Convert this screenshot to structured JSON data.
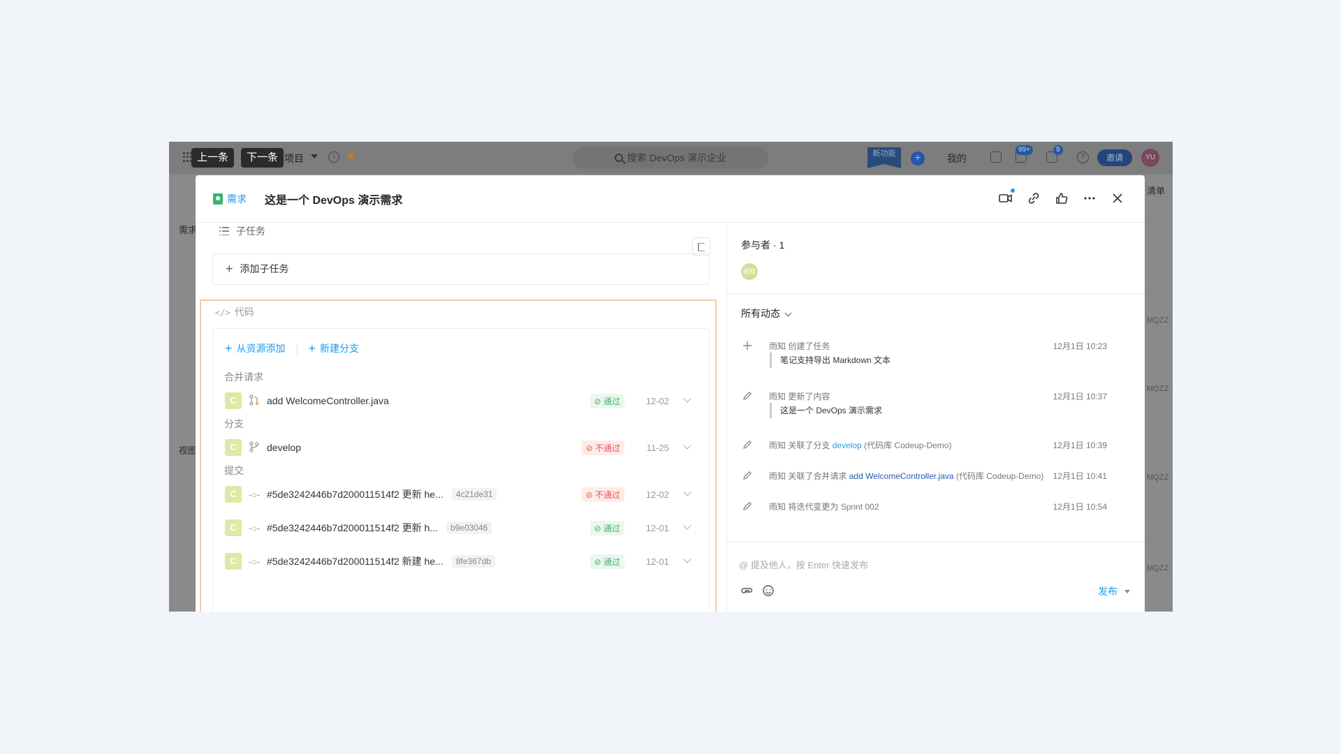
{
  "topbar": {
    "prev": "上一条",
    "next": "下一条",
    "project": "项目",
    "search_placeholder": "搜索 DevOps 演示企业",
    "new_feature": "新功能",
    "mine": "我的",
    "badge_notify": "99+",
    "badge_msg": "9",
    "invite": "邀请",
    "avatar": "YU"
  },
  "background": {
    "left_req": "需求",
    "left_view": "视图",
    "right_list": "清单",
    "mqzz": "MQZZ"
  },
  "modal": {
    "tag": "需求",
    "title": "这是一个 DevOps 演示需求",
    "subtask": {
      "label": "子任务",
      "add": "添加子任务"
    },
    "code": {
      "label": "代码",
      "add_from_resource": "从资源添加",
      "new_branch": "新建分支",
      "merge_title": "合并请求",
      "branch_title": "分支",
      "commit_title": "提交",
      "merge_rows": [
        {
          "badge": "C",
          "text": "add WelcomeController.java",
          "status": "通过",
          "date": "12-02"
        }
      ],
      "branch_rows": [
        {
          "badge": "C",
          "text": "develop",
          "status": "不通过",
          "date": "11-25"
        }
      ],
      "commit_rows": [
        {
          "badge": "C",
          "text": "#5de3242446b7d200011514f2 更新 he...",
          "hash": "4c21de31",
          "status": "不通过",
          "date": "12-02"
        },
        {
          "badge": "C",
          "text": "#5de3242446b7d200011514f2 更新 h...",
          "hash": "b9e03046",
          "status": "通过",
          "date": "12-01"
        },
        {
          "badge": "C",
          "text": "#5de3242446b7d200011514f2 新建 he...",
          "hash": "8fe367db",
          "status": "通过",
          "date": "12-01"
        }
      ]
    },
    "right": {
      "participants": "参与者 · 1",
      "participant_avatar": "雨知",
      "all_activity": "所有动态",
      "activities": [
        {
          "actor": "雨知",
          "action": "创建了任务",
          "time": "12月1日 10:23",
          "quote": "笔记支持导出 Markdown 文本"
        },
        {
          "actor": "雨知",
          "action": "更新了内容",
          "time": "12月1日 10:37",
          "quote": "这是一个 DevOps 演示需求"
        },
        {
          "actor": "雨知",
          "action": "关联了分支",
          "link": "develop",
          "suffix": "(代码库 Codeup-Demo)",
          "time": "12月1日 10:39"
        },
        {
          "actor": "雨知",
          "action": "关联了合并请求",
          "link": "add WelcomeController.java",
          "suffix": "(代码库 Codeup-Demo)",
          "time": "12月1日 10:41"
        },
        {
          "actor": "雨知",
          "action": "将迭代变更为 Sprint 002",
          "time": "12月1日 10:54"
        }
      ],
      "comment_placeholder": "@ 提及他人，按 Enter 快速发布",
      "publish": "发布"
    }
  },
  "colors": {
    "accent": "#1b9aee",
    "pass": "#45b36b",
    "fail": "#e5584c",
    "highlight_border": "#f7c8a1"
  }
}
